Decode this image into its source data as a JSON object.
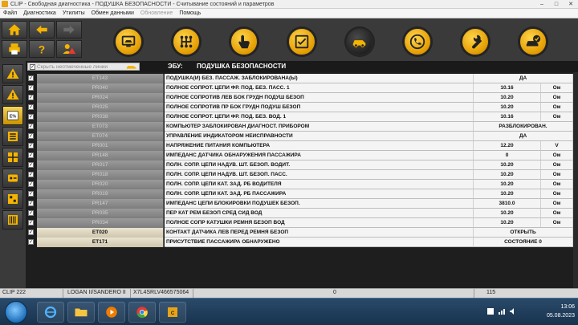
{
  "window": {
    "title": "CLIP - Свободная диагностика - ПОДУШКА БЕЗОПАСНОСТИ - Считывание состояний и параметров"
  },
  "menu": [
    "Файл",
    "Диагностика",
    "Утилиты",
    "Обмен данными",
    "Обновление",
    "Помощь"
  ],
  "menu_disabled_index": 4,
  "header": {
    "hide_label": "Скрыть неотмеченные линии",
    "ecu_label": "ЭБУ:",
    "ecu_name": "ПОДУШКА БЕЗОПАСНОСТИ"
  },
  "rows": [
    {
      "code": "ET143",
      "desc": "ПОДУШКА(И) БЕЗ. ПАССАЖ. ЗАБЛОКИРОВАНА(Ы)",
      "value": "ДА",
      "unit": "",
      "active": false
    },
    {
      "code": "PR040",
      "desc": "ПОЛНОЕ СОПРОТ. ЦЕПИ ФР. ПОД. БЕЗ. ПАСС. 1",
      "value": "10.16",
      "unit": "Ом",
      "active": false
    },
    {
      "code": "PR024",
      "desc": "ПОЛНОЕ СОПРОТИВ ЛЕВ БОК ГРУДН ПОДУШ БЕЗОП",
      "value": "10.20",
      "unit": "Ом",
      "active": false
    },
    {
      "code": "PR025",
      "desc": "ПОЛНОЕ СОПРОТИВ ПР БОК ГРУДН ПОДУШ БЕЗОП",
      "value": "10.20",
      "unit": "Ом",
      "active": false
    },
    {
      "code": "PR038",
      "desc": "ПОЛНОЕ СОПРОТ. ЦЕПИ ФР. ПОД. БЕЗ. ВОД. 1",
      "value": "10.16",
      "unit": "Ом",
      "active": false
    },
    {
      "code": "ET073",
      "desc": "КОМПЬЮТЕР ЗАБЛОКИРОВАН ДИАГНОСТ. ПРИБОРОМ",
      "value": "РАЗБЛОКИРОВАН.",
      "unit": "",
      "active": false
    },
    {
      "code": "ET074",
      "desc": "УПРАВЛЕНИЕ ИНДИКАТОРОМ НЕИСПРАВНОСТИ",
      "value": "ДА",
      "unit": "",
      "active": false
    },
    {
      "code": "PR001",
      "desc": "НАПРЯЖЕНИЕ ПИТАНИЯ КОМПЬЮТЕРА",
      "value": "12.20",
      "unit": "V",
      "active": false
    },
    {
      "code": "PR148",
      "desc": "ИМПЕДАНС ДАТЧИКА ОБНАРУЖЕНИЯ ПАССАЖИРА",
      "value": "0",
      "unit": "Ом",
      "active": false
    },
    {
      "code": "PR017",
      "desc": "ПОЛН. СОПР. ЦЕПИ НАДУВ. ШТ. БЕЗОП. ВОДИТ.",
      "value": "10.20",
      "unit": "Ом",
      "active": false
    },
    {
      "code": "PR018",
      "desc": "ПОЛН. СОПР. ЦЕПИ НАДУВ. ШТ. БЕЗОП. ПАСС.",
      "value": "10.20",
      "unit": "Ом",
      "active": false
    },
    {
      "code": "PR020",
      "desc": "ПОЛН. СОПР. ЦЕПИ КАТ. ЗАД. РБ ВОДИТЕЛЯ",
      "value": "10.20",
      "unit": "Ом",
      "active": false
    },
    {
      "code": "PR019",
      "desc": "ПОЛН. СОПР. ЦЕПИ КАТ. ЗАД. РБ ПАССАЖИРА",
      "value": "10.20",
      "unit": "Ом",
      "active": false
    },
    {
      "code": "PR147",
      "desc": "ИМПЕДАНС ЦЕПИ БЛОКИРОВКИ ПОДУШЕК БЕЗОП.",
      "value": "3810.0",
      "unit": "Ом",
      "active": false
    },
    {
      "code": "PR035",
      "desc": "ПЕР КАТ РЕМ БЕЗОП СРЕД СИД ВОД",
      "value": "10.20",
      "unit": "Ом",
      "active": false
    },
    {
      "code": "PR034",
      "desc": "ПОЛНОЕ СОПР КАТУШКИ РЕМНЯ БЕЗОП ВОД",
      "value": "10.20",
      "unit": "Ом",
      "active": false
    },
    {
      "code": "ET020",
      "desc": "КОНТАКТ ДАТЧИКА ЛЕВ ПЕРЕД РЕМНЯ БЕЗОП",
      "value": "ОТКРЫТЬ",
      "unit": "",
      "active": true
    },
    {
      "code": "ET171",
      "desc": "ПРИСУТСТВИЕ ПАССАЖИРА ОБНАРУЖЕНО",
      "value": "СОСТОЯНИЕ 0",
      "unit": "",
      "active": true
    }
  ],
  "status": {
    "clip": "CLIP 222",
    "vehicle": "LOGAN II/SANDERO II",
    "vin": "X7L4SRLV466575064",
    "counter": "0",
    "right": "115"
  },
  "taskbar": {
    "time": "13:06",
    "date": "05.08.2023"
  },
  "colors": {
    "accent": "#f5b400",
    "row_bg": "#f4f4f4",
    "code_bg": "#8a8a8a",
    "active_code_bg": "#ddd5bd"
  }
}
